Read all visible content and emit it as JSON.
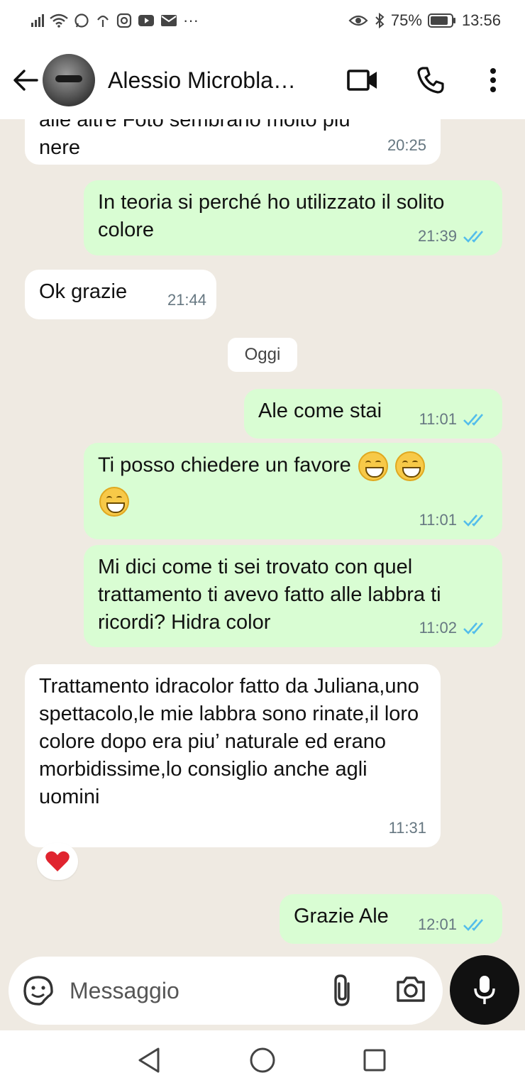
{
  "status_bar": {
    "battery": "75%",
    "time": "13:56",
    "more": "···"
  },
  "header": {
    "contact_name": "Alessio Microbla…"
  },
  "messages": [
    {
      "id": "m1",
      "direction": "in",
      "text_partial_top": "alle altre Foto sembrano molto più",
      "text": "nere",
      "time": "20:25"
    },
    {
      "id": "m2",
      "direction": "out",
      "text": "In teoria si perché ho utilizzato il solito colore",
      "time": "21:39",
      "read": true
    },
    {
      "id": "m3",
      "direction": "in",
      "text": "Ok grazie",
      "time": "21:44"
    },
    {
      "id": "m5",
      "direction": "out",
      "text": "Ale come stai",
      "time": "11:01",
      "read": true
    },
    {
      "id": "m6",
      "direction": "out",
      "text": "Ti posso chiedere un favore",
      "emoji_count": 3,
      "time": "11:01",
      "read": true
    },
    {
      "id": "m7",
      "direction": "out",
      "text": "Mi dici come ti sei trovato con quel trattamento ti avevo fatto alle labbra ti ricordi? Hidra color",
      "time": "11:02",
      "read": true
    },
    {
      "id": "m8",
      "direction": "in",
      "text": "Trattamento idracolor fatto da Juliana,uno spettacolo,le mie labbra sono rinate,il loro colore dopo era piu’ naturale ed erano morbidissime,lo consiglio anche agli uomini",
      "time": "11:31",
      "reaction": "red-heart"
    },
    {
      "id": "m9",
      "direction": "out",
      "text": "Grazie Ale",
      "time": "12:01",
      "read": true
    }
  ],
  "date_separator": "Oggi",
  "composer": {
    "placeholder": "Messaggio"
  },
  "colors": {
    "outgoing_bubble": "#d9fdd3",
    "incoming_bubble": "#ffffff",
    "chat_background": "#efeae2",
    "read_ticks": "#53bdeb",
    "mic_button": "#111111"
  }
}
